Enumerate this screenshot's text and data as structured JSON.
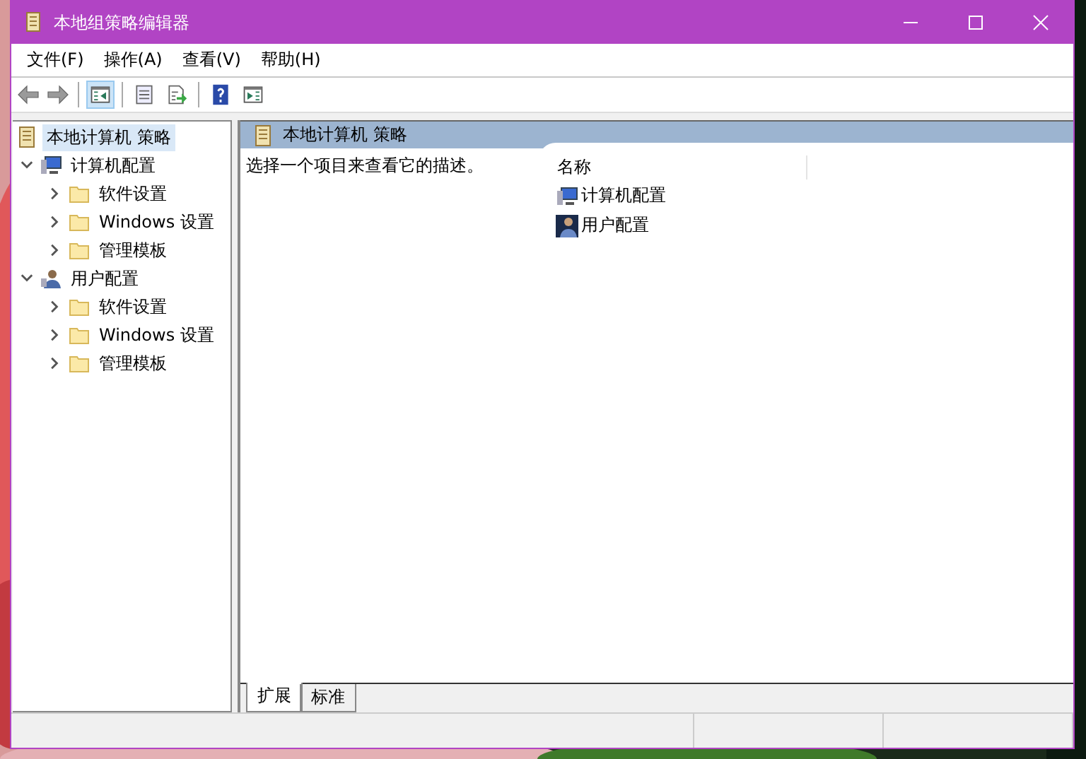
{
  "window": {
    "title": "本地组策略编辑器"
  },
  "menu": [
    "文件(F)",
    "操作(A)",
    "查看(V)",
    "帮助(H)"
  ],
  "toolbar": [
    {
      "kind": "back",
      "disabled": true
    },
    {
      "kind": "forward",
      "disabled": true
    },
    {
      "kind": "separator"
    },
    {
      "kind": "tree-toggle",
      "pressed": true
    },
    {
      "kind": "separator"
    },
    {
      "kind": "properties",
      "pressed": false
    },
    {
      "kind": "export",
      "pressed": false
    },
    {
      "kind": "separator"
    },
    {
      "kind": "help",
      "pressed": false
    },
    {
      "kind": "action-pane",
      "pressed": false
    }
  ],
  "tree": [
    {
      "label": "本地计算机 策略",
      "kind": "policy",
      "selected": true,
      "children": [
        {
          "label": "计算机配置",
          "kind": "computer",
          "selected": false,
          "expanded": true,
          "children": [
            {
              "label": "软件设置",
              "kind": "folder",
              "selected": false,
              "expanded": false
            },
            {
              "label": "Windows 设置",
              "kind": "folder",
              "selected": false,
              "expanded": false
            },
            {
              "label": "管理模板",
              "kind": "folder",
              "selected": false,
              "expanded": false
            }
          ]
        },
        {
          "label": "用户配置",
          "kind": "user",
          "selected": false,
          "expanded": true,
          "children": [
            {
              "label": "软件设置",
              "kind": "folder",
              "selected": false,
              "expanded": false
            },
            {
              "label": "Windows 设置",
              "kind": "folder",
              "selected": false,
              "expanded": false
            },
            {
              "label": "管理模板",
              "kind": "folder",
              "selected": false,
              "expanded": false
            }
          ]
        }
      ]
    }
  ],
  "details": {
    "title": "本地计算机 策略",
    "description": "选择一个项目来查看它的描述。",
    "columns": [
      "名称"
    ],
    "rows": [
      {
        "name": "计算机配置",
        "kind": "computer"
      },
      {
        "name": "用户配置",
        "kind": "user"
      }
    ]
  },
  "bottom_tabs": [
    {
      "label": "扩展",
      "selected": true
    },
    {
      "label": "标准",
      "selected": false
    }
  ]
}
